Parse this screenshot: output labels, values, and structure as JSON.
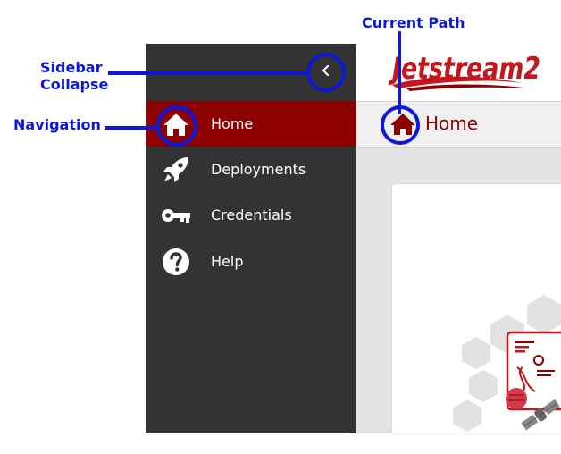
{
  "annotations": {
    "current_path": "Current Path",
    "sidebar_collapse": "Sidebar\nCollapse",
    "navigation": "Navigation"
  },
  "header": {
    "logo_text": "Jetstream2",
    "collapse_icon": "chevron-left-icon"
  },
  "sidebar": {
    "items": [
      {
        "label": "Home",
        "icon": "home-icon",
        "active": true
      },
      {
        "label": "Deployments",
        "icon": "rocket-icon",
        "active": false
      },
      {
        "label": "Credentials",
        "icon": "key-icon",
        "active": false
      },
      {
        "label": "Help",
        "icon": "help-circle-icon",
        "active": false
      }
    ]
  },
  "breadcrumb": {
    "icon": "home-icon",
    "label": "Home"
  },
  "colors": {
    "annotation": "#0b17d9",
    "sidebar_bg": "#333333",
    "active_item": "#8d0000",
    "brand": "#c4161c"
  }
}
